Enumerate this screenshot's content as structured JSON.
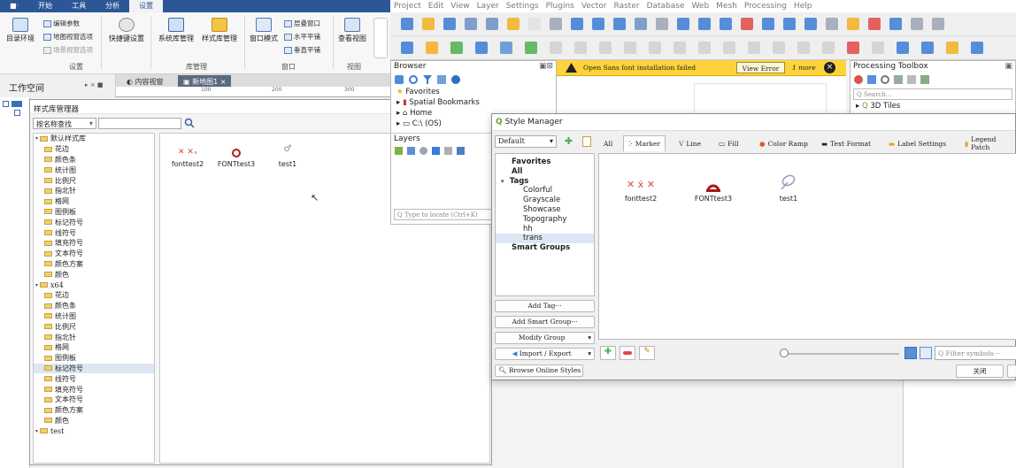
{
  "left_app": {
    "ribbon_tabs": [
      "■·",
      "开始",
      "工具",
      "分析",
      "设置"
    ],
    "active_tab_index": 4,
    "ribbon": {
      "dir_env": "目录环境",
      "edit_params": "编辑参数",
      "map_view_opts": "地图视窗选项",
      "scene_view_opts": "场景视窗选项",
      "shortcut_settings": "快捷键设置",
      "system_lib": "系统库管理",
      "style_lib": "样式库管理",
      "window_mode": "窗口模式",
      "stack_windows": "层叠窗口",
      "tile_h": "水平平铺",
      "tile_v": "垂直平铺",
      "view_views": "查看视图",
      "groups": [
        "设置",
        "库管理",
        "窗口",
        "视图"
      ]
    },
    "workspace_label": "工作空间",
    "workspace_ctrl": "▸ × ■",
    "doc_tabs": [
      "内容视窗",
      "新地图1"
    ],
    "ruler_marks": [
      "100",
      "200",
      "300"
    ]
  },
  "style_lib_dialog": {
    "title": "样式库管理器",
    "search_select": "按名称查找",
    "tree": [
      {
        "level": 0,
        "label": "默认样式库"
      },
      {
        "level": 1,
        "label": "花边"
      },
      {
        "level": 1,
        "label": "颜色条"
      },
      {
        "level": 1,
        "label": "统计图"
      },
      {
        "level": 1,
        "label": "比例尺"
      },
      {
        "level": 1,
        "label": "指北针"
      },
      {
        "level": 1,
        "label": "格网"
      },
      {
        "level": 1,
        "label": "图例板"
      },
      {
        "level": 1,
        "label": "标记符号"
      },
      {
        "level": 1,
        "label": "线符号"
      },
      {
        "level": 1,
        "label": "填充符号"
      },
      {
        "level": 1,
        "label": "文本符号"
      },
      {
        "level": 1,
        "label": "颜色方案"
      },
      {
        "level": 1,
        "label": "颜色"
      },
      {
        "level": 0,
        "label": "x64"
      },
      {
        "level": 1,
        "label": "花边"
      },
      {
        "level": 1,
        "label": "颜色条"
      },
      {
        "level": 1,
        "label": "统计图"
      },
      {
        "level": 1,
        "label": "比例尺"
      },
      {
        "level": 1,
        "label": "指北针"
      },
      {
        "level": 1,
        "label": "格网"
      },
      {
        "level": 1,
        "label": "图例板"
      },
      {
        "level": 1,
        "label": "标记符号",
        "selected": true
      },
      {
        "level": 1,
        "label": "线符号"
      },
      {
        "level": 1,
        "label": "填充符号"
      },
      {
        "level": 1,
        "label": "文本符号"
      },
      {
        "level": 1,
        "label": "颜色方案"
      },
      {
        "level": 1,
        "label": "颜色"
      },
      {
        "level": 0,
        "label": "test"
      }
    ],
    "symbols": [
      "fonttest2",
      "FONTtest3",
      "test1"
    ]
  },
  "qgis": {
    "menu": [
      "Project",
      "Edit",
      "View",
      "Layer",
      "Settings",
      "Plugins",
      "Vector",
      "Raster",
      "Database",
      "Web",
      "Mesh",
      "Processing",
      "Help"
    ],
    "browser": {
      "title": "Browser",
      "items": [
        "Favorites",
        "Spatial Bookmarks",
        "Home",
        "C:\\ (OS)"
      ],
      "layers_title": "Layers",
      "locate_placeholder": "Q  Type to locate (Ctrl+K)"
    },
    "warning": {
      "text": "Open Sans font installation failed",
      "button": "View Error",
      "more": "1 more"
    },
    "processing": {
      "title": "Processing Toolbox",
      "search_placeholder": "Q  Search...",
      "item": "3D Tiles"
    }
  },
  "style_manager": {
    "title": "Style Manager",
    "library_select": "Default",
    "tabs": [
      "All",
      "Marker",
      "Line",
      "Fill",
      "Color Ramp",
      "Text Format",
      "Label Settings",
      "Legend Patch"
    ],
    "active_tab_index": 1,
    "groups": [
      {
        "label": "Favorites",
        "bold": true,
        "indent": 0
      },
      {
        "label": "All",
        "bold": true,
        "indent": 0
      },
      {
        "label": "Tags",
        "bold": true,
        "indent": 0,
        "expanded": true
      },
      {
        "label": "Colorful",
        "indent": 1
      },
      {
        "label": "Grayscale",
        "indent": 1
      },
      {
        "label": "Showcase",
        "indent": 1
      },
      {
        "label": "Topography",
        "indent": 1
      },
      {
        "label": "hh",
        "indent": 1
      },
      {
        "label": "trans",
        "indent": 1,
        "selected": true
      },
      {
        "label": "Smart Groups",
        "bold": true,
        "indent": 0
      }
    ],
    "buttons": {
      "add_tag": "Add Tag···",
      "add_smart_group": "Add Smart Group···",
      "modify_group": "Modify Group",
      "import_export": "Import / Export",
      "browse_online": "Browse Online Styles",
      "close": "关闭"
    },
    "filter_placeholder": "Filter symbols···",
    "symbols": [
      "fonttest2",
      "FONTtest3",
      "test1"
    ]
  },
  "colors": {
    "ribbon_blue": "#2b5797",
    "warn_yellow": "#fdd33b",
    "selection": "#dde6f2"
  }
}
